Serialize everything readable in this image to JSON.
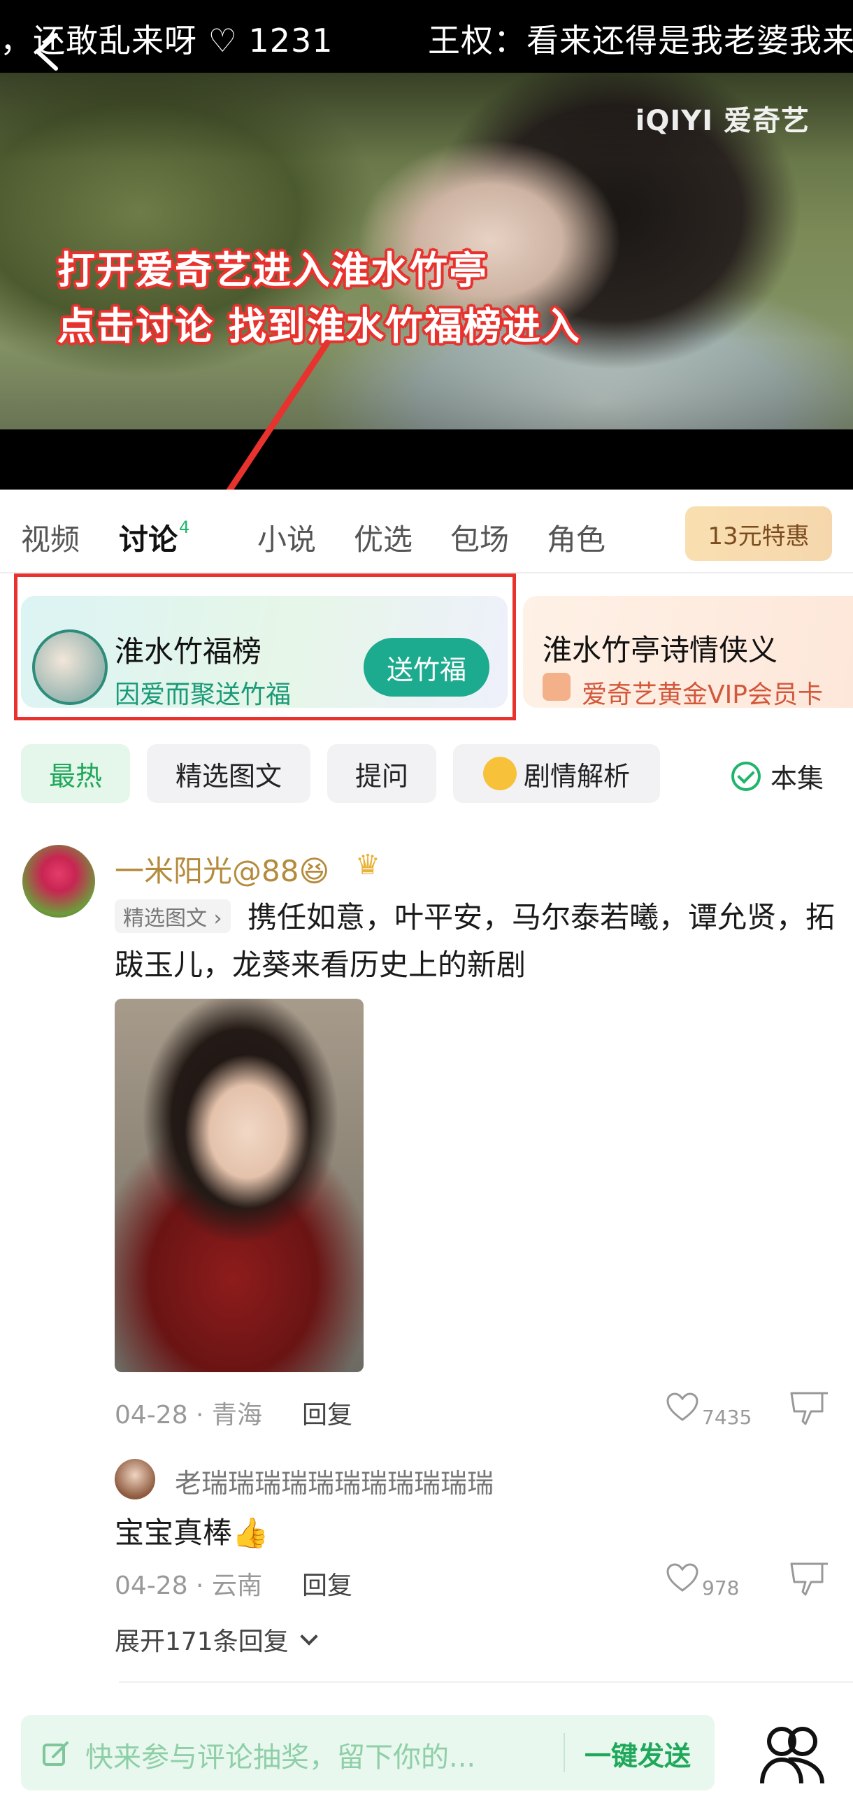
{
  "video": {
    "danmaku_left": "，还敢乱来呀 ♡ 1231",
    "danmaku_right": "王权：看来还得是我老婆我来",
    "watermark": "iQIYI 爱奇艺",
    "annotation_line1": "打开爱奇艺进入淮水竹亭",
    "annotation_line2": "点击讨论 找到淮水竹福榜进入"
  },
  "tabs": {
    "items": [
      "视频",
      "讨论",
      "小说",
      "优选",
      "包场",
      "角色"
    ],
    "active_index": 1,
    "discussion_count": "4",
    "promo": "13元特惠"
  },
  "cards": [
    {
      "title": "淮水竹福榜",
      "subtitle": "因爱而聚送竹福",
      "button": "送竹福"
    },
    {
      "title": "淮水竹亭诗情侠义",
      "subtitle": "爱奇艺黄金VIP会员卡"
    }
  ],
  "filters": {
    "chips": [
      "最热",
      "精选图文",
      "提问",
      "剧情解析"
    ],
    "this_episode": "本集"
  },
  "post": {
    "username": "一米阳光@88😆",
    "tag": "精选图文 ›",
    "text": "携任如意，叶平安，马尔泰若曦，谭允贤，拓跋玉儿，龙葵来看历史上的新剧",
    "meta": "04-28 · 青海",
    "reply_label": "回复",
    "likes": "7435"
  },
  "sub_comment": {
    "username": "老瑞瑞瑞瑞瑞瑞瑞瑞瑞瑞瑞",
    "text": "宝宝真棒👍",
    "meta": "04-28 · 云南",
    "reply_label": "回复",
    "likes": "978"
  },
  "expand_label": "展开171条回复",
  "comment_bar": {
    "placeholder": "快来参与评论抽奖，留下你的...",
    "send_label": "一键发送"
  },
  "colors": {
    "accent_green": "#1fa85a",
    "highlight_red": "#e8322e",
    "card_button": "#1cab8e"
  }
}
